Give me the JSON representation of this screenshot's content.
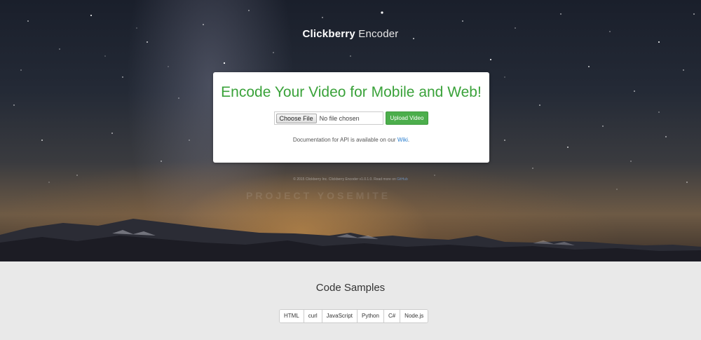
{
  "brand": {
    "bold": "Clickberry",
    "light": "Encoder"
  },
  "card": {
    "title": "Encode Your Video for Mobile and Web!",
    "choose_file_label": "Choose File",
    "file_status": "No file chosen",
    "upload_label": "Upload Video",
    "doc_text": "Documentation for API is available on our",
    "doc_link": "Wiki",
    "doc_suffix": "."
  },
  "footer": {
    "text": "© 2015 Clickberry Inc. Clickberry Encoder v1.0.1.0. Read more on",
    "link": "GitHub",
    "watermark": "PROJECT YOSEMITE"
  },
  "samples": {
    "title": "Code Samples",
    "tabs": [
      "HTML",
      "curl",
      "JavaScript",
      "Python",
      "C#",
      "Node.js"
    ]
  },
  "colors": {
    "title_green": "#3aa23a",
    "button_green": "#4cae4c",
    "link_blue": "#2a7fd0"
  }
}
